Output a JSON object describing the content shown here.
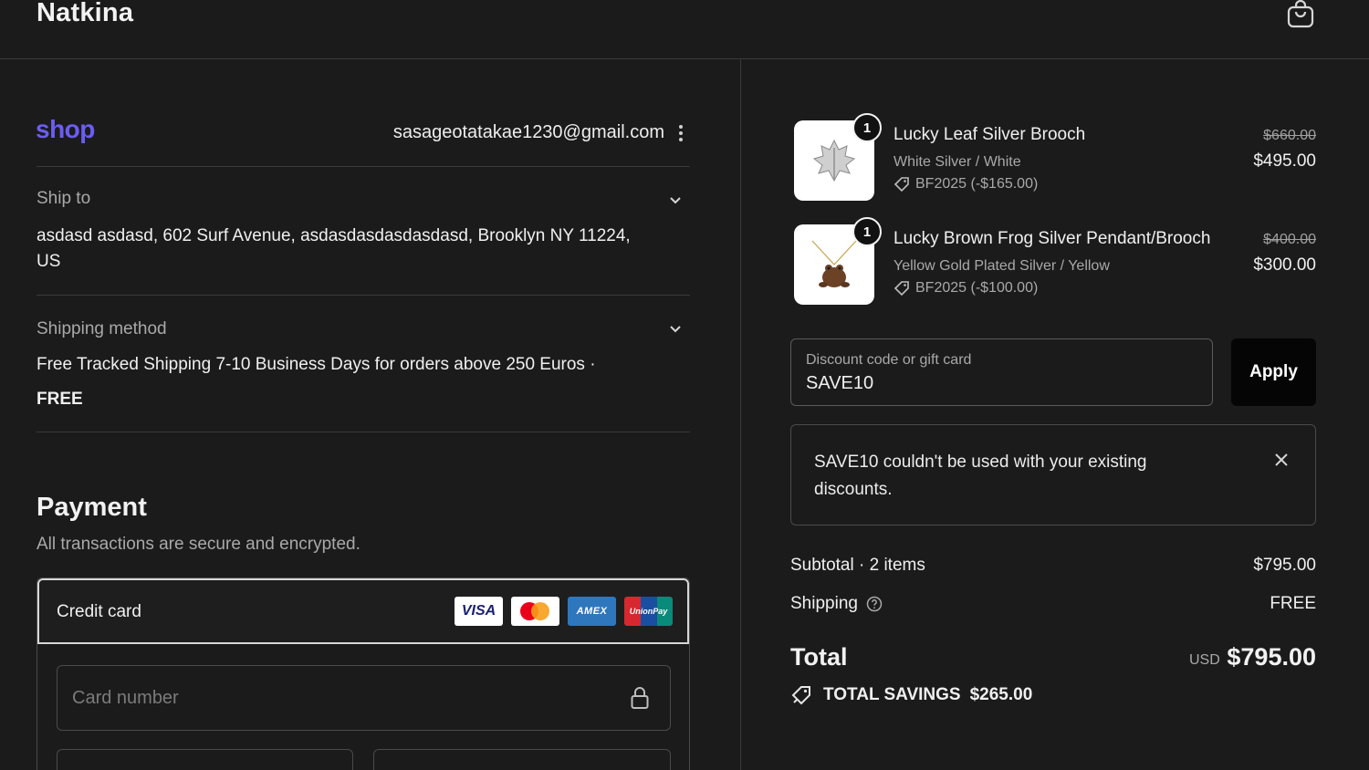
{
  "header": {
    "brand": "Natkina",
    "cart_icon": "shopping-bag-icon"
  },
  "account": {
    "shop_logo": "shop",
    "email": "sasageotatakae1230@gmail.com"
  },
  "ship_to": {
    "label": "Ship to",
    "address": "asdasd asdasd, 602 Surf Avenue, asdasdasdasdasdasd, Brooklyn NY 11224, US"
  },
  "shipping_method": {
    "label": "Shipping method",
    "description": "Free Tracked Shipping 7-10 Business Days for orders above 250 Euros ·",
    "price": "FREE"
  },
  "payment": {
    "title": "Payment",
    "subtitle": "All transactions are secure and encrypted.",
    "method_label": "Credit card",
    "card_brands": [
      "VISA",
      "Mastercard",
      "AMEX",
      "UnionPay"
    ],
    "card_number_placeholder": "Card number"
  },
  "items": [
    {
      "quantity": "1",
      "name": "Lucky Leaf Silver Brooch",
      "variant": "White Silver / White",
      "discount": "BF2025 (-$165.00)",
      "original_price": "$660.00",
      "price": "$495.00"
    },
    {
      "quantity": "1",
      "name": "Lucky Brown Frog Silver Pendant/Brooch",
      "variant": "Yellow Gold Plated Silver / Yellow",
      "discount": "BF2025 (-$100.00)",
      "original_price": "$400.00",
      "price": "$300.00"
    }
  ],
  "discount": {
    "label": "Discount code or gift card",
    "value": "SAVE10",
    "apply_label": "Apply",
    "notice": "SAVE10 couldn't be used with your existing discounts."
  },
  "summary": {
    "subtotal_label": "Subtotal · 2 items",
    "subtotal_value": "$795.00",
    "shipping_label": "Shipping",
    "shipping_value": "FREE",
    "total_label": "Total",
    "currency": "USD",
    "total_value": "$795.00",
    "savings_label": "TOTAL SAVINGS",
    "savings_value": "$265.00"
  },
  "colors": {
    "background": "#1b1b1c",
    "shop_accent": "#6b5df2",
    "button": "#050505"
  }
}
